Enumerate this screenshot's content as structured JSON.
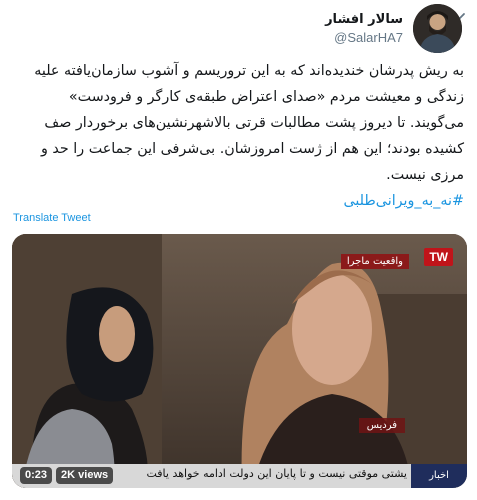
{
  "author": {
    "display_name": "سالار افشار",
    "handle": "@SalarHA7",
    "avatar_icon": "profile-avatar"
  },
  "tweet": {
    "text": "به ریش پدرشان خندیده‌اند که به این تروریسم و آشوب سازمان‌یافته علیه زندگی و معیشت مردم «صدای اعتراض طبقه‌ی کارگر و فرودست» می‌گویند. تا دیروز پشت مطالبات قرتی بالاشهرنشین‌های برخوردار صف کشیده بودند؛ این هم از ژست امروزشان. بی‌شرفی این جماعت را حد و مرزی نیست.",
    "hashtag": "#نه_به_ویرانی‌طلبی",
    "translate_label": "Translate Tweet"
  },
  "video": {
    "duration": "0:23",
    "views": "2K views",
    "channel_logo": "TW",
    "program_tag": "واقعیت ماجرا",
    "location_tag": "فردیس",
    "ticker_text": "یشتی موقتی نیست و تا پایان این دولت ادامه خواهد یافت",
    "ticker_label": "اخبار"
  },
  "colors": {
    "link": "#1b95e0",
    "text": "#14171a",
    "secondary": "#657786"
  }
}
